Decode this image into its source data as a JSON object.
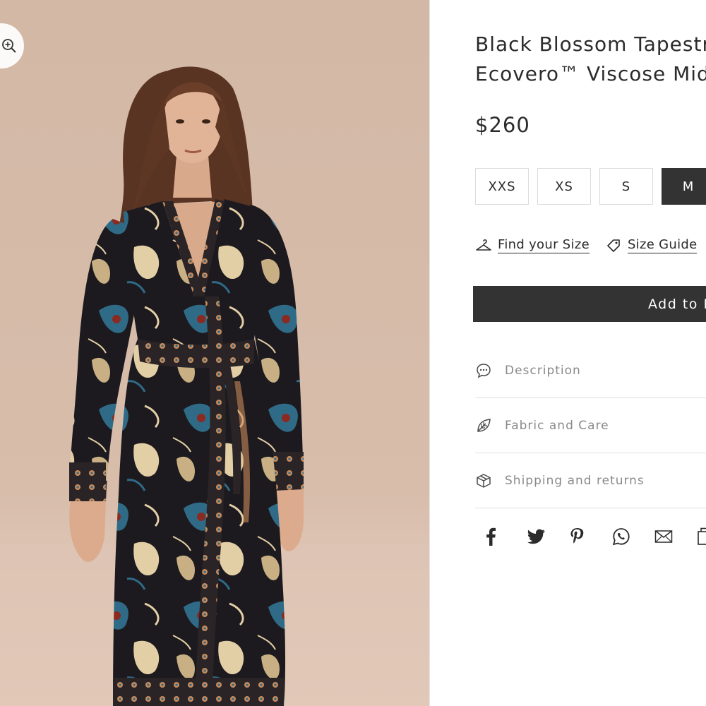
{
  "product": {
    "title_line1": "Black Blossom Tapestry",
    "title_line2": "Ecovero™ Viscose Midi Dress",
    "price": "$260"
  },
  "sizes": [
    {
      "label": "XXS",
      "selected": false
    },
    {
      "label": "XS",
      "selected": false
    },
    {
      "label": "S",
      "selected": false
    },
    {
      "label": "M",
      "selected": true
    }
  ],
  "size_links": {
    "find_your_size": "Find your Size",
    "size_guide": "Size Guide"
  },
  "add_to_bag": "Add to Bag",
  "accordion": [
    {
      "label": "Description",
      "icon": "chat-bubble-icon"
    },
    {
      "label": "Fabric and Care",
      "icon": "leaf-icon"
    },
    {
      "label": "Shipping and returns",
      "icon": "box-icon"
    }
  ],
  "share_icons": [
    "facebook-icon",
    "twitter-icon",
    "pinterest-icon",
    "whatsapp-icon",
    "email-icon",
    "copy-link-icon"
  ],
  "colors": {
    "text": "#2b2b2b",
    "button_dark": "#333333",
    "muted": "#8a8a8a",
    "photo_bg": "#d6bba9",
    "dress_dark": "#1c1a1e",
    "dress_teal": "#2f6a87",
    "dress_cream": "#e3cfa6"
  }
}
